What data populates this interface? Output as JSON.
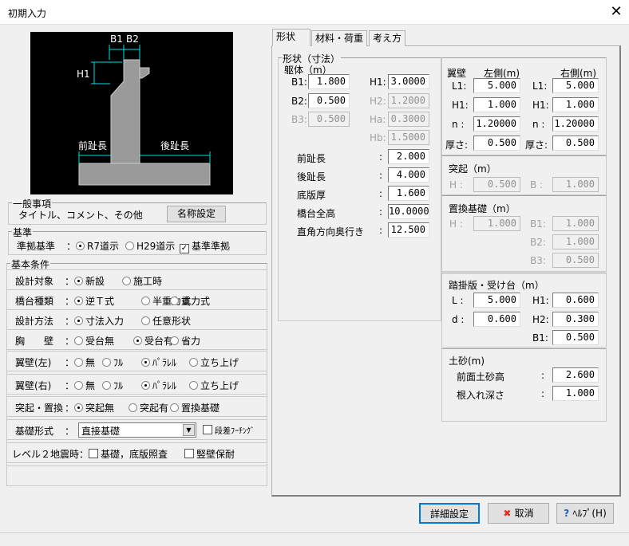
{
  "window": {
    "title": "初期入力",
    "close": "✕"
  },
  "drawing": {
    "b1": "B1",
    "b2": "B2",
    "h1": "H1",
    "toe_front": "前趾長",
    "toe_back": "後趾長"
  },
  "general": {
    "title": "一般事項",
    "text": "タイトル、コメント、その他",
    "button": "名称設定"
  },
  "standard": {
    "title": "基準",
    "label": "準拠基準",
    "colon": "：",
    "opt1": "R7道示",
    "opt2": "H29道示",
    "check": "基準準拠",
    "selected": "R7道示",
    "checked": true
  },
  "basic": {
    "title": "基本条件",
    "rows": [
      {
        "label": "設計対象",
        "opts": [
          "新設",
          "施工時"
        ],
        "sel": 0
      },
      {
        "label": "橋台種類",
        "opts": [
          "逆Ｔ式",
          "半重力式",
          "重力式"
        ],
        "sel": 0
      },
      {
        "label": "設計方法",
        "opts": [
          "寸法入力",
          "任意形状"
        ],
        "sel": 0
      },
      {
        "label": "胸　　壁",
        "opts": [
          "受台無",
          "受台有",
          "省力"
        ],
        "sel": 1
      },
      {
        "label": "翼壁(左)",
        "opts": [
          "無",
          "ﾌﾙ",
          "ﾊﾟﾗﾚﾙ",
          "立ち上げ"
        ],
        "sel": 2
      },
      {
        "label": "翼壁(右)",
        "opts": [
          "無",
          "ﾌﾙ",
          "ﾊﾟﾗﾚﾙ",
          "立ち上げ"
        ],
        "sel": 2
      },
      {
        "label": "突起・置換",
        "opts": [
          "突起無",
          "突起有",
          "置換基礎"
        ],
        "sel": 0
      }
    ],
    "foundation_label": "基礎形式",
    "foundation_value": "直接基礎",
    "step_footing": "段差ﾌｰﾁﾝｸﾞ",
    "level2_label": "レベル２地震時：",
    "level2_opt1": "基礎，底版照査",
    "level2_opt2": "竪壁保耐"
  },
  "tabs": [
    "形状",
    "材料・荷重",
    "考え方"
  ],
  "shape": {
    "title": "形状（寸法）",
    "body": "躯体（m）",
    "B1": "1.800",
    "B2": "0.500",
    "B3": "0.500",
    "H1": "3.0000",
    "H2": "1.2000",
    "Ha": "0.3000",
    "Hb": "1.5000",
    "labels": {
      "B1": "B1:",
      "B2": "B2:",
      "B3": "B3:",
      "H1": "H1:",
      "H2": "H2:",
      "Ha": "Ha:",
      "Hb": "Hb:"
    },
    "rows": [
      {
        "label": "前趾長",
        "value": "2.000"
      },
      {
        "label": "後趾長",
        "value": "4.000"
      },
      {
        "label": "底版厚",
        "value": "1.600"
      },
      {
        "label": "橋台全高",
        "value": "10.0000"
      },
      {
        "label": "直角方向奥行き",
        "value": "12.500"
      }
    ],
    "colon": ":"
  },
  "wing": {
    "title": "翼壁",
    "left": "左側(m)",
    "right": "右側(m)",
    "labels": [
      "L1:",
      "H1:",
      "n :",
      "厚さ:"
    ],
    "left_vals": [
      "5.000",
      "1.000",
      "1.20000",
      "0.500"
    ],
    "right_vals": [
      "5.000",
      "1.000",
      "1.20000",
      "0.500"
    ]
  },
  "protrusion": {
    "title": "突起（m）",
    "h_label": "H :",
    "h": "0.500",
    "b_label": "B :",
    "b": "1.000"
  },
  "replace": {
    "title": "置換基礎（m）",
    "h_label": "H :",
    "h": "1.000",
    "b1_label": "B1:",
    "b1": "1.000",
    "b2_label": "B2:",
    "b2": "1.000",
    "b3_label": "B3:",
    "b3": "0.500"
  },
  "approach": {
    "title": "踏掛版・受け台（m）",
    "l_label": "L :",
    "l": "5.000",
    "d_label": "d :",
    "d": "0.600",
    "h1_label": "H1:",
    "h1": "0.600",
    "h2_label": "H2:",
    "h2": "0.300",
    "b1_label": "B1:",
    "b1": "0.500"
  },
  "soil": {
    "title": "土砂(m)",
    "front_label": "前面土砂高",
    "front": "2.600",
    "embed_label": "根入れ深さ",
    "embed": "1.000",
    "colon": ":"
  },
  "buttons": {
    "detail": "詳細設定",
    "cancel": "取消",
    "help": "ﾍﾙﾌﾟ(H)"
  }
}
